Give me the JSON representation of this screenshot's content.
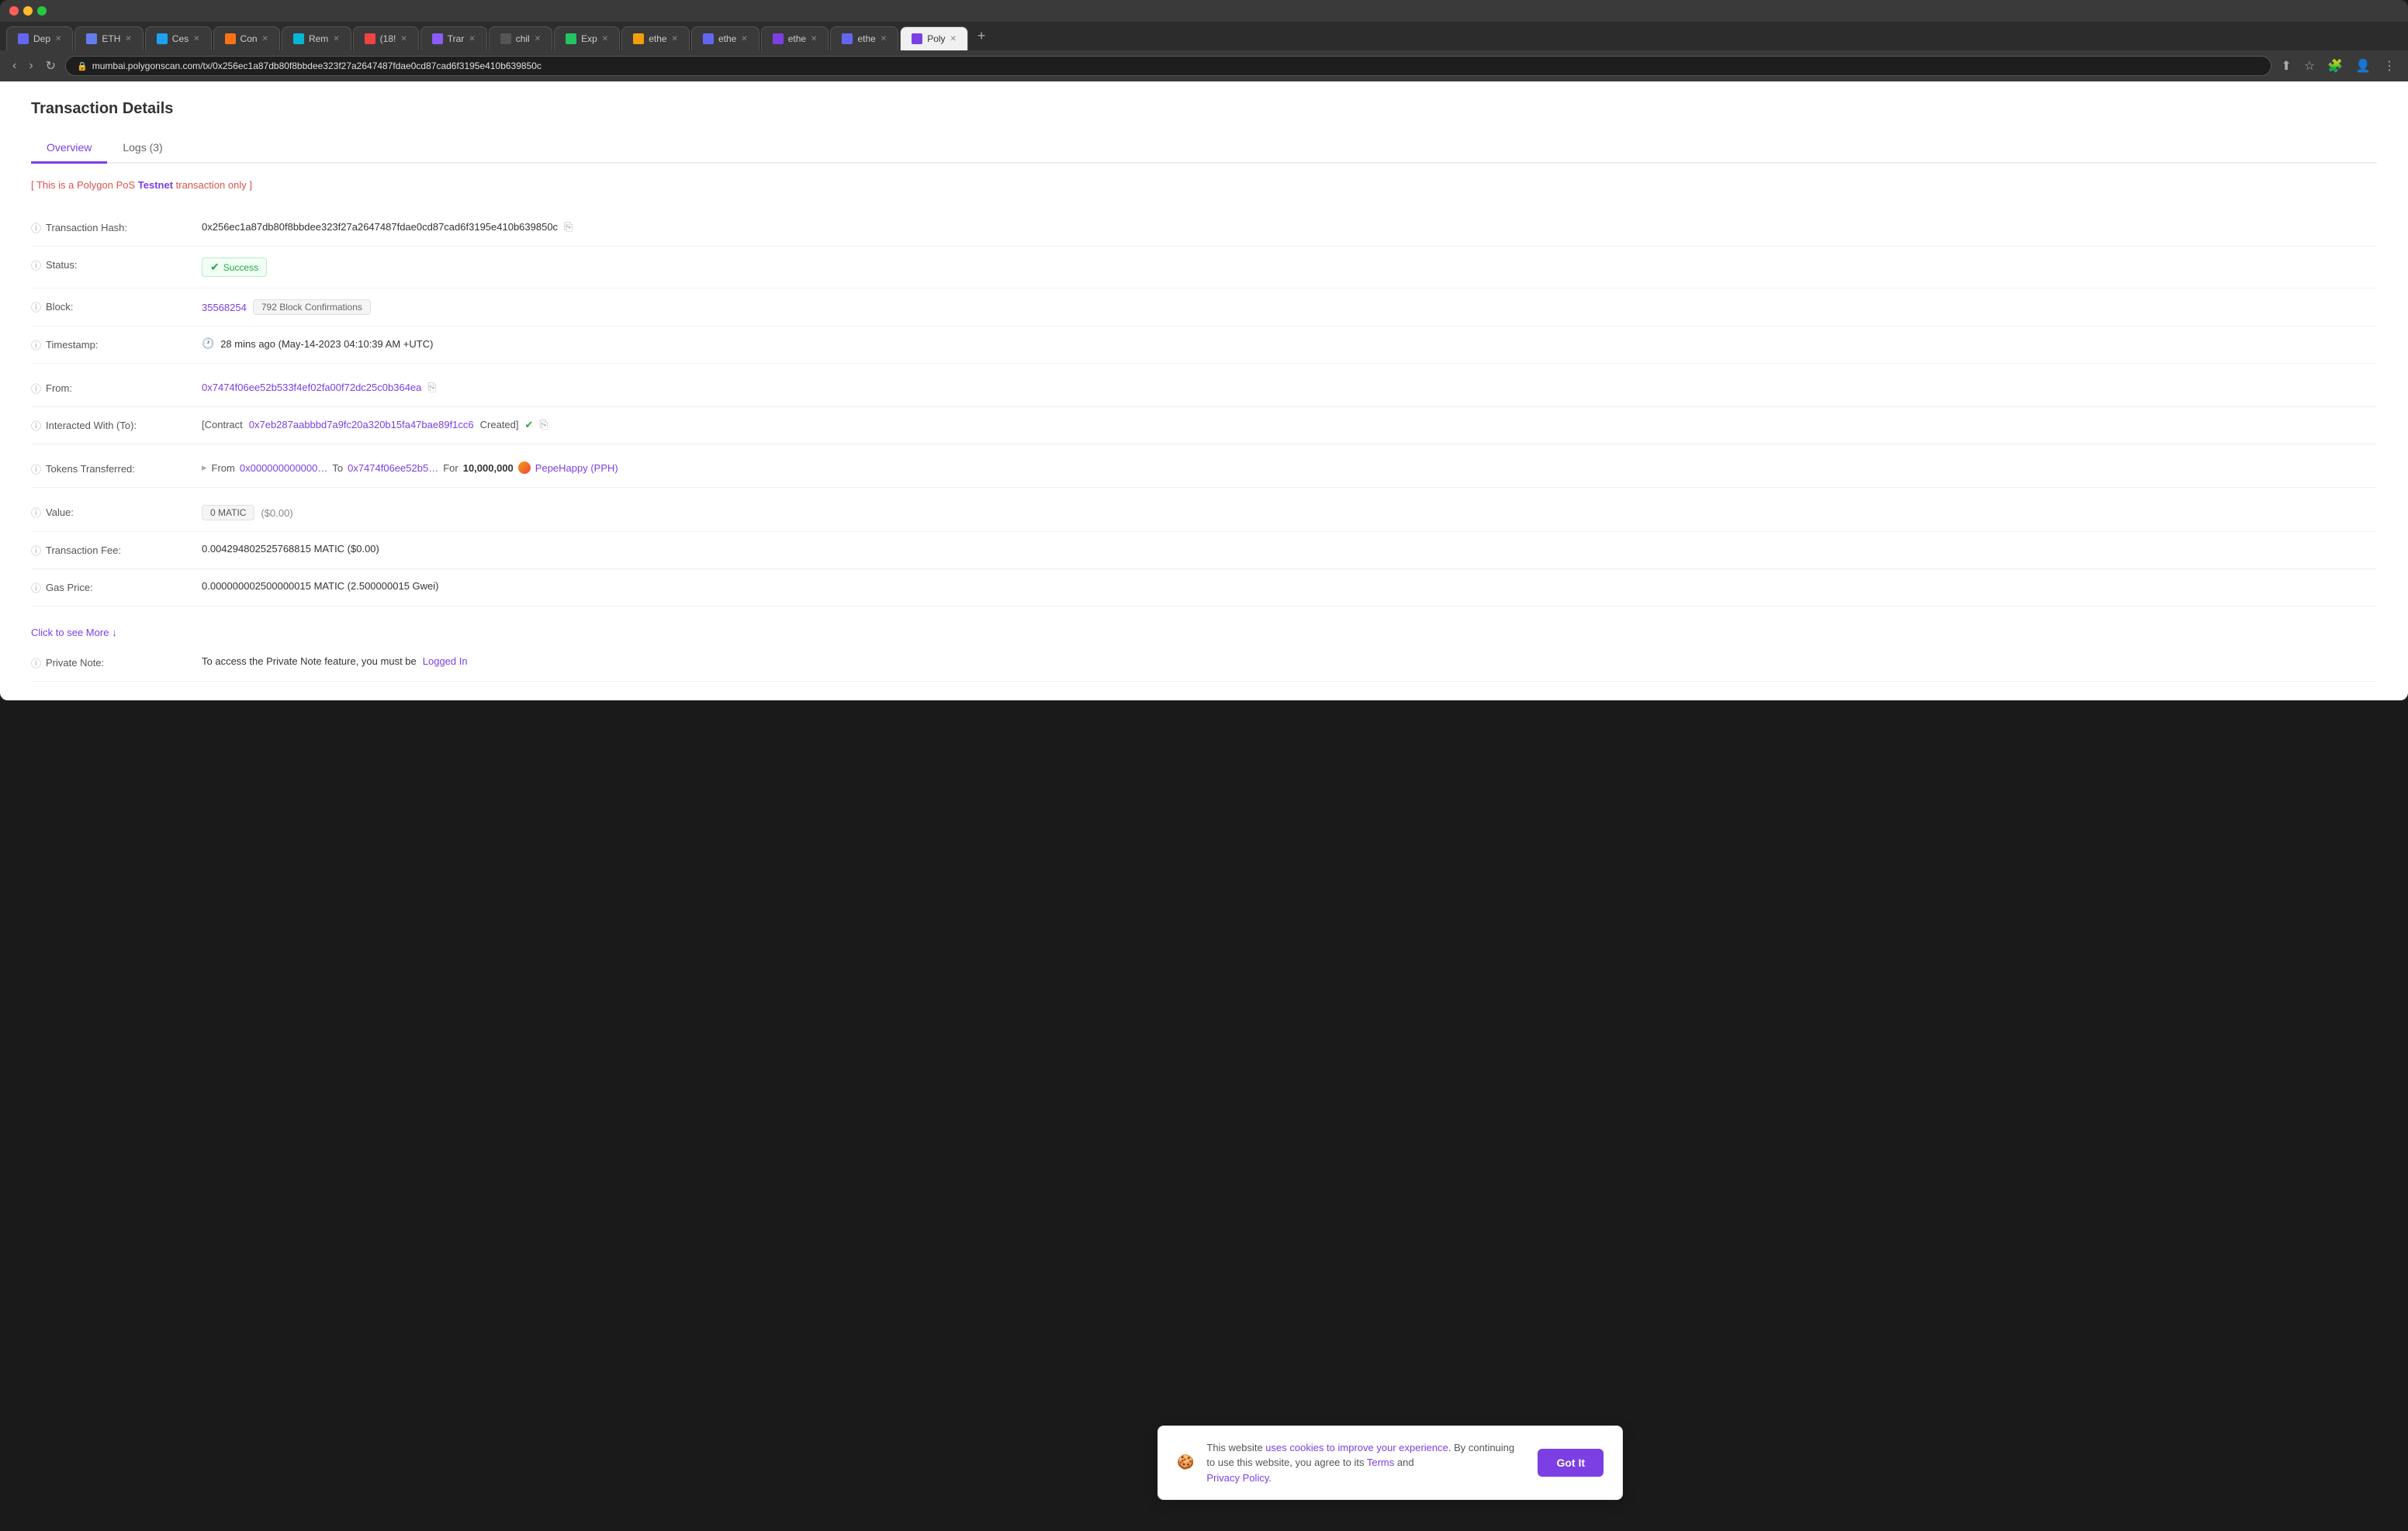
{
  "browser": {
    "url": "mumbai.polygonscan.com/tx/0x256ec1a87db80f8bbdee323f27a2647487fdae0cd87cad6f3195e410b639850c",
    "tabs": [
      {
        "id": 1,
        "label": "Dep",
        "active": false,
        "color": "#6366f1"
      },
      {
        "id": 2,
        "label": "ETH",
        "active": false,
        "color": "#627eea"
      },
      {
        "id": 3,
        "label": "Ces",
        "active": false,
        "color": "#1da1f2"
      },
      {
        "id": 4,
        "label": "Con",
        "active": false,
        "color": "#f97316"
      },
      {
        "id": 5,
        "label": "Rem",
        "active": false,
        "color": "#06b6d4"
      },
      {
        "id": 6,
        "label": "(18!",
        "active": false,
        "color": "#ef4444"
      },
      {
        "id": 7,
        "label": "Trar",
        "active": false,
        "color": "#8b5cf6"
      },
      {
        "id": 8,
        "label": "chil",
        "active": false,
        "color": "#333"
      },
      {
        "id": 9,
        "label": "Exp",
        "active": false,
        "color": "#22c55e"
      },
      {
        "id": 10,
        "label": "ethe",
        "active": false,
        "color": "#f59e0b"
      },
      {
        "id": 11,
        "label": "ethe",
        "active": false,
        "color": "#6366f1"
      },
      {
        "id": 12,
        "label": "ethe",
        "active": false,
        "color": "#7b3fe4"
      },
      {
        "id": 13,
        "label": "ethe",
        "active": false,
        "color": "#6366f1"
      },
      {
        "id": 14,
        "label": "Poly",
        "active": true,
        "color": "#7b3fe4"
      }
    ]
  },
  "page": {
    "title": "Transaction Details",
    "tabs": {
      "overview": "Overview",
      "logs": "Logs (3)"
    },
    "active_tab": "overview"
  },
  "testnet_notice": {
    "prefix": "[ This is a Polygon PoS ",
    "highlight": "Testnet",
    "suffix": " transaction only ]"
  },
  "details": {
    "transaction_hash": {
      "label": "Transaction Hash:",
      "value": "0x256ec1a87db80f8bbdee323f27a2647487fdae0cd87cad6f3195e410b639850c"
    },
    "status": {
      "label": "Status:",
      "value": "Success"
    },
    "block": {
      "label": "Block:",
      "number": "35568254",
      "confirmations": "792 Block Confirmations"
    },
    "timestamp": {
      "label": "Timestamp:",
      "value": "28 mins ago (May-14-2023 04:10:39 AM +UTC)"
    },
    "from": {
      "label": "From:",
      "value": "0x7474f06ee52b533f4ef02fa00f72dc25c0b364ea"
    },
    "interacted_with": {
      "label": "Interacted With (To):",
      "prefix": "[Contract ",
      "contract": "0x7eb287aabbbd7a9fc20a320b15fa47bae89f1cc6",
      "suffix": " Created]"
    },
    "tokens_transferred": {
      "label": "Tokens Transferred:",
      "arrow": "▸",
      "from_label": "From",
      "from_address": "0x000000000000…",
      "to_label": "To",
      "to_address": "0x7474f06ee52b5…",
      "for_label": "For",
      "amount": "10,000,000",
      "token_name": "PepeHappy (PPH)"
    },
    "value": {
      "label": "Value:",
      "matic": "0 MATIC",
      "usd": "($0.00)"
    },
    "transaction_fee": {
      "label": "Transaction Fee:",
      "value": "0.004294802525768815 MATIC ($0.00)"
    },
    "gas_price": {
      "label": "Gas Price:",
      "value": "0.000000002500000015 MATIC (2.500000015 Gwei)"
    },
    "private_note": {
      "label": "Private Note:",
      "prefix": "To access the Private Note feature, you must be ",
      "link_text": "Logged In"
    }
  },
  "click_more": {
    "label": "Click to see More",
    "arrow": "↓"
  },
  "cookie_banner": {
    "text_before": "This website ",
    "link1_text": "uses cookies to improve your experience",
    "text_middle": ". By continuing to use this website, you agree to its ",
    "link2_text": "Terms",
    "text_and": " and ",
    "link3_text": "Privacy Policy",
    "text_end": ".",
    "button_label": "Got It"
  }
}
